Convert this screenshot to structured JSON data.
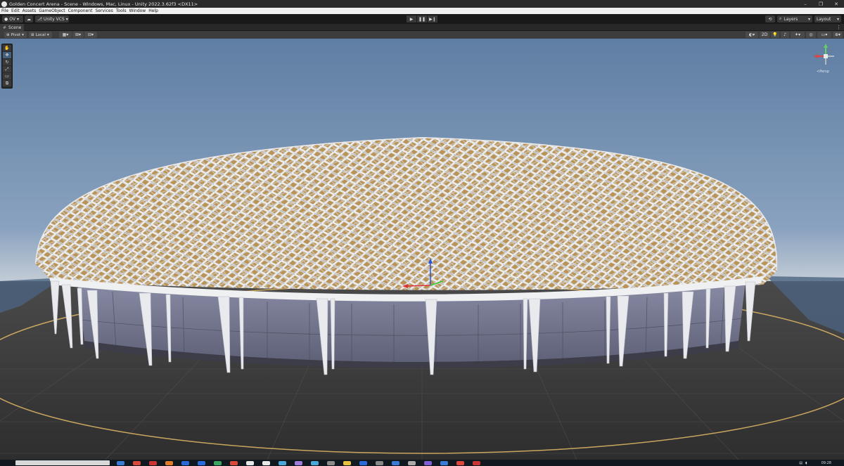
{
  "window": {
    "title": "Golden Concert Arena - Scene - Windows, Mac, Linux - Unity 2022.3.62f3 <DX11>",
    "controls": [
      "–",
      "❐",
      "✕"
    ]
  },
  "menu": {
    "items": [
      "File",
      "Edit",
      "Assets",
      "GameObject",
      "Component",
      "Services",
      "Tools",
      "Window",
      "Help"
    ]
  },
  "toolbar": {
    "account_label": "OV",
    "vcs_label": "Unity VCS",
    "play_buttons": [
      "▶",
      "❚❚",
      "▶❙"
    ],
    "layers_label": "Layers",
    "layout_label": "Layout"
  },
  "scene_tab": {
    "label": "Scene"
  },
  "scene_toolbar": {
    "pivot_label": "Pivot",
    "local_label": "Local",
    "mode_2d": "2D"
  },
  "viewport": {
    "persp_label": "<Persp",
    "colors": {
      "sky_top": "#5f7ea3",
      "sky_horizon": "#c4cdd6",
      "ground": "#3e3e3e",
      "facade": "#7c7e98",
      "lattice": "#e6e6e8",
      "panel_gold": "#b28d55"
    }
  },
  "tools": [
    "hand-tool",
    "move-tool",
    "rotate-tool",
    "scale-tool",
    "rect-tool",
    "transform-tool"
  ],
  "taskbar": {
    "time": "09:28",
    "app_colors": [
      "#3a7bd5",
      "#d9483b",
      "#c33",
      "#e07b2a",
      "#2a6bd9",
      "#2a6bd9",
      "#3aa55e",
      "#d9483b",
      "#e8e8e8",
      "#e8e8e8",
      "#4aa8d9",
      "#9d7cd8",
      "#4aa8d9",
      "#8b8b8b",
      "#e8c040",
      "#2a6bd9",
      "#888",
      "#3a7bd5",
      "#aaa",
      "#7d5fd3",
      "#3a7bd5",
      "#d9483b",
      "#c33"
    ]
  }
}
